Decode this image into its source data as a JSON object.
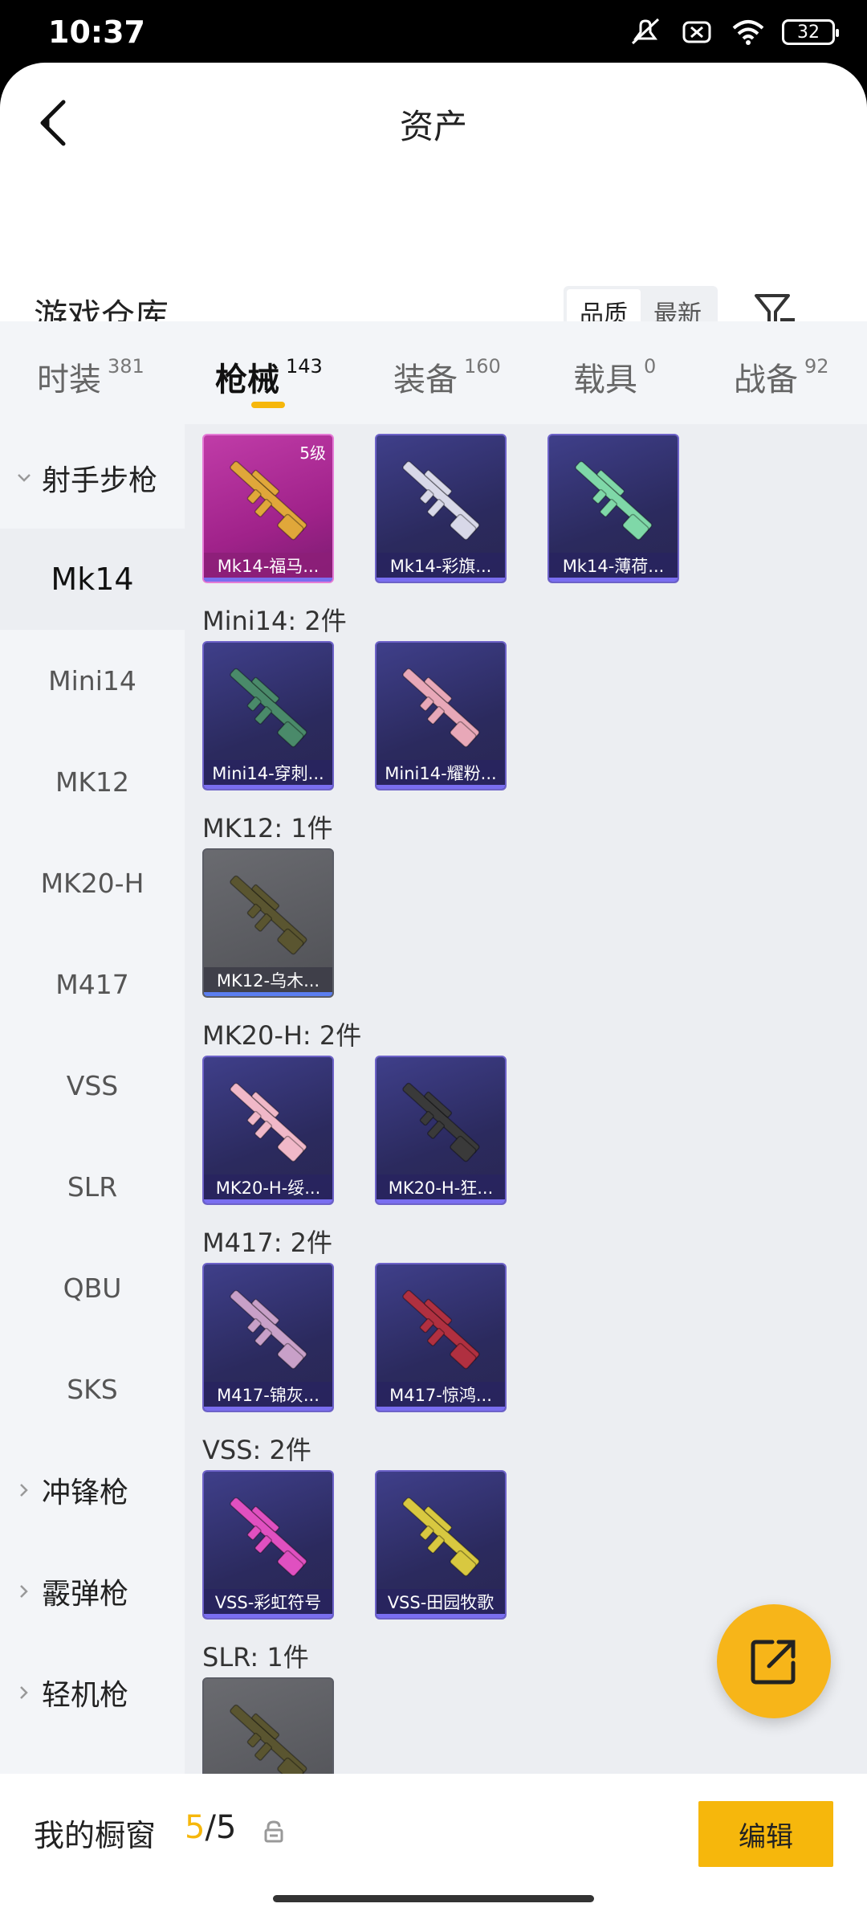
{
  "status": {
    "time": "10:37",
    "battery": "32"
  },
  "header": {
    "title": "资产"
  },
  "warehouse": {
    "title": "游戏仓库",
    "sort_options": [
      "品质",
      "最新"
    ],
    "sort_selected": "品质"
  },
  "tabs": [
    {
      "label": "时装",
      "count": "381"
    },
    {
      "label": "枪械",
      "count": "143",
      "active": true
    },
    {
      "label": "装备",
      "count": "160"
    },
    {
      "label": "载具",
      "count": "0"
    },
    {
      "label": "战备",
      "count": "92"
    }
  ],
  "sidebar": [
    {
      "label": "射手步枪",
      "type": "group",
      "expanded": true
    },
    {
      "label": "Mk14",
      "type": "sub",
      "active": true
    },
    {
      "label": "Mini14",
      "type": "sub"
    },
    {
      "label": "MK12",
      "type": "sub"
    },
    {
      "label": "MK20-H",
      "type": "sub"
    },
    {
      "label": "M417",
      "type": "sub"
    },
    {
      "label": "VSS",
      "type": "sub"
    },
    {
      "label": "SLR",
      "type": "sub"
    },
    {
      "label": "QBU",
      "type": "sub"
    },
    {
      "label": "SKS",
      "type": "sub"
    },
    {
      "label": "冲锋枪",
      "type": "group"
    },
    {
      "label": "霰弹枪",
      "type": "group"
    },
    {
      "label": "轻机枪",
      "type": "group"
    }
  ],
  "groups": [
    {
      "label": "",
      "items": [
        {
          "name": "Mk14-福马...",
          "style": "pink",
          "level": "5级",
          "gun_color": "#e0a73a"
        },
        {
          "name": "Mk14-彩旗...",
          "style": "purple",
          "gun_color": "#d8d8e8"
        },
        {
          "name": "Mk14-薄荷...",
          "style": "purple",
          "gun_color": "#7fd8a8"
        }
      ]
    },
    {
      "label": "Mini14: 2件",
      "items": [
        {
          "name": "Mini14-穿刺...",
          "style": "purple",
          "gun_color": "#4a8a6a"
        },
        {
          "name": "Mini14-耀粉...",
          "style": "purple",
          "gun_color": "#e8a8b8"
        }
      ]
    },
    {
      "label": "MK12: 1件",
      "items": [
        {
          "name": "MK12-乌木...",
          "style": "gray",
          "gun_color": "#5a5530"
        }
      ]
    },
    {
      "label": "MK20-H: 2件",
      "items": [
        {
          "name": "MK20-H-绥...",
          "style": "purple",
          "gun_color": "#f0b8c8"
        },
        {
          "name": "MK20-H-狂...",
          "style": "purple",
          "gun_color": "#3a3a3a"
        }
      ]
    },
    {
      "label": "M417: 2件",
      "items": [
        {
          "name": "M417-锦灰...",
          "style": "purple",
          "gun_color": "#c8a0c8"
        },
        {
          "name": "M417-惊鸿...",
          "style": "purple",
          "gun_color": "#b03040"
        }
      ]
    },
    {
      "label": "VSS: 2件",
      "items": [
        {
          "name": "VSS-彩虹符号",
          "style": "purple",
          "gun_color": "#e050c0"
        },
        {
          "name": "VSS-田园牧歌",
          "style": "purple",
          "gun_color": "#d8c840"
        }
      ]
    },
    {
      "label": "SLR: 1件",
      "items": [
        {
          "name": "",
          "style": "gray",
          "gun_color": "#5a5530"
        }
      ]
    }
  ],
  "showcase": {
    "label": "我的橱窗",
    "current": "5",
    "total": "5",
    "edit_label": "编辑"
  },
  "colors": {
    "accent": "#f6b70c"
  }
}
